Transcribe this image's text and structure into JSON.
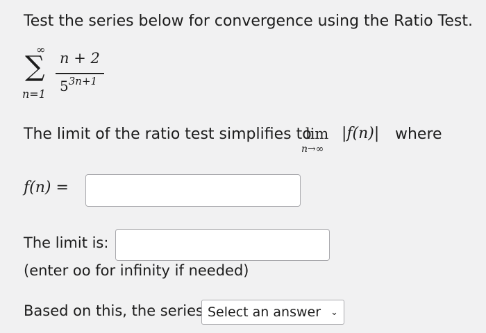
{
  "question": {
    "prompt": "Test the series below for convergence using the Ratio Test."
  },
  "series": {
    "sum_upper": "∞",
    "sum_lower": "n=1",
    "numerator": "n + 2",
    "denominator_base": "5",
    "denominator_exponent": "3n+1"
  },
  "ratio": {
    "text_before": "The limit of the ratio test simplifies to",
    "lim": "lim",
    "lim_sub": "n→∞",
    "expr": "|f(n)|",
    "text_after": "where"
  },
  "fn_field": {
    "label": "f(n) =",
    "value": ""
  },
  "limit_field": {
    "label": "The limit is:",
    "value": "",
    "hint": "(enter oo for infinity if needed)"
  },
  "conclusion": {
    "label": "Based on this, the series",
    "select_value": "Select an answer"
  },
  "icons": {
    "dropdown": "chevron-down-icon"
  }
}
